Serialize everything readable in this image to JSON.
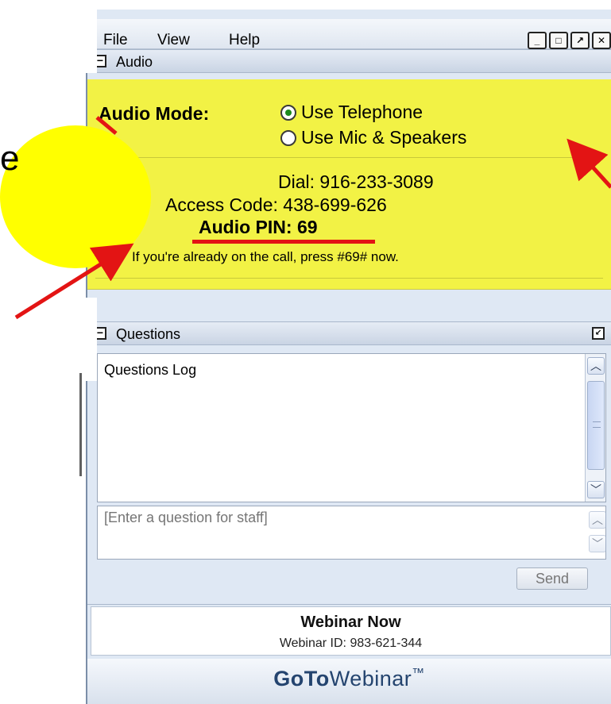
{
  "slide": {
    "partial_char": "e"
  },
  "menu": {
    "file": "File",
    "view": "View",
    "help": "Help",
    "buttons": [
      "minimize-icon",
      "maximize-icon",
      "popout-icon",
      "close-icon"
    ]
  },
  "audio": {
    "header": "Audio",
    "mode_label": "Audio Mode:",
    "option_telephone": "Use Telephone",
    "option_mic": "Use Mic & Speakers",
    "selected": "telephone",
    "dial_label": "Dial:",
    "dial_value": "916-233-3089",
    "access_label": "Access Code:",
    "access_value": "438-699-626",
    "pin_label": "Audio PIN:",
    "pin_value": "69",
    "note": "If you're already on the call, press #69# now."
  },
  "questions": {
    "header": "Questions",
    "log_label": "Questions Log",
    "input_placeholder": "[Enter a question for staff]",
    "send_label": "Send"
  },
  "footer": {
    "title": "Webinar Now",
    "id_line": "Webinar ID: 983-621-344",
    "brand_bold": "GoTo",
    "brand_rest": "Webinar",
    "brand_tm": "™"
  },
  "colors": {
    "audio_highlight": "#f2f245",
    "annotation_red": "#e31414",
    "brand_blue": "#24446f"
  }
}
